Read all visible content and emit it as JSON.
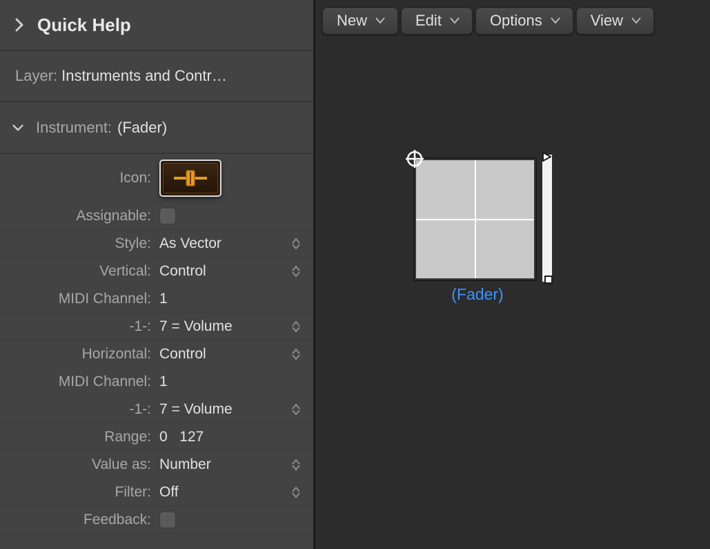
{
  "quick_help": {
    "title": "Quick Help"
  },
  "layer_row": {
    "label": "Layer:",
    "value": "Instruments and Contr…"
  },
  "instrument_header": {
    "label": "Instrument:",
    "value": "(Fader)"
  },
  "props": {
    "icon": {
      "label": "Icon:"
    },
    "assignable": {
      "label": "Assignable:"
    },
    "style": {
      "label": "Style:",
      "value": "As Vector"
    },
    "vertical": {
      "label": "Vertical:",
      "value": "Control"
    },
    "midi_ch_v": {
      "label": "MIDI Channel:",
      "value": "1"
    },
    "cc_v": {
      "label": "-1-:",
      "value": "7 = Volume"
    },
    "horizontal": {
      "label": "Horizontal:",
      "value": "Control"
    },
    "midi_ch_h": {
      "label": "MIDI Channel:",
      "value": "1"
    },
    "cc_h": {
      "label": "-1-:",
      "value": "7 = Volume"
    },
    "range": {
      "label": "Range:",
      "value": "0   127"
    },
    "value_as": {
      "label": "Value as:",
      "value": "Number"
    },
    "filter": {
      "label": "Filter:",
      "value": "Off"
    },
    "feedback": {
      "label": "Feedback:"
    }
  },
  "toolbar": {
    "new": {
      "label": "New"
    },
    "edit": {
      "label": "Edit"
    },
    "options": {
      "label": "Options"
    },
    "view": {
      "label": "View"
    }
  },
  "canvas": {
    "fader_label": "(Fader)"
  }
}
